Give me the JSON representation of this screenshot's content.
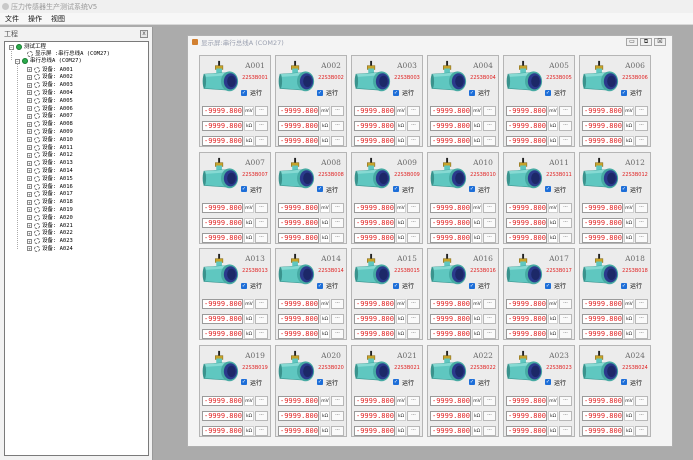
{
  "window": {
    "title": "压力传感器生产测试系统V5"
  },
  "menu": [
    "文件",
    "操作",
    "视图"
  ],
  "left_panel": {
    "title": "工程",
    "close_label": "x",
    "project_label": "测试工程",
    "display_label": "显示屏 :串行总线A (COM27)",
    "bus_label": "串行总线A (COM27)",
    "devices": [
      "设备: A001",
      "设备: A002",
      "设备: A003",
      "设备: A004",
      "设备: A005",
      "设备: A006",
      "设备: A007",
      "设备: A008",
      "设备: A009",
      "设备: A010",
      "设备: A011",
      "设备: A012",
      "设备: A013",
      "设备: A014",
      "设备: A015",
      "设备: A016",
      "设备: A017",
      "设备: A018",
      "设备: A019",
      "设备: A020",
      "设备: A021",
      "设备: A022",
      "设备: A023",
      "设备: A024"
    ]
  },
  "child_window": {
    "title": "显示屏:串行总线A (COM27)"
  },
  "run_label": "运行",
  "value_text": "-9999.800",
  "unit_mv": "mV",
  "unit_kohm": "kΩ",
  "more_label": "...",
  "cards": [
    {
      "name": "A001",
      "code": "22S3B001"
    },
    {
      "name": "A002",
      "code": "22S3B002"
    },
    {
      "name": "A003",
      "code": "22S3B003"
    },
    {
      "name": "A004",
      "code": "22S3B004"
    },
    {
      "name": "A005",
      "code": "22S3B005"
    },
    {
      "name": "A006",
      "code": "22S3B006"
    },
    {
      "name": "A007",
      "code": "22S3B007"
    },
    {
      "name": "A008",
      "code": "22S3B008"
    },
    {
      "name": "A009",
      "code": "22S3B009"
    },
    {
      "name": "A010",
      "code": "22S3B010"
    },
    {
      "name": "A011",
      "code": "22S3B011"
    },
    {
      "name": "A012",
      "code": "22S3B012"
    },
    {
      "name": "A013",
      "code": "22S3B013"
    },
    {
      "name": "A014",
      "code": "22S3B014"
    },
    {
      "name": "A015",
      "code": "22S3B015"
    },
    {
      "name": "A016",
      "code": "22S3B016"
    },
    {
      "name": "A017",
      "code": "22S3B017"
    },
    {
      "name": "A018",
      "code": "22S3B018"
    },
    {
      "name": "A019",
      "code": "22S3B019"
    },
    {
      "name": "A020",
      "code": "22S3B020"
    },
    {
      "name": "A021",
      "code": "22S3B021"
    },
    {
      "name": "A022",
      "code": "22S3B022"
    },
    {
      "name": "A023",
      "code": "22S3B023"
    },
    {
      "name": "A024",
      "code": "22S3B024"
    }
  ],
  "colors": {
    "value_red": "#e02020",
    "checkbox_blue": "#1d6ed8",
    "status_green": "#2cab4c",
    "pump_body": "#5fc7c0",
    "pump_face": "#2b3a8c"
  }
}
